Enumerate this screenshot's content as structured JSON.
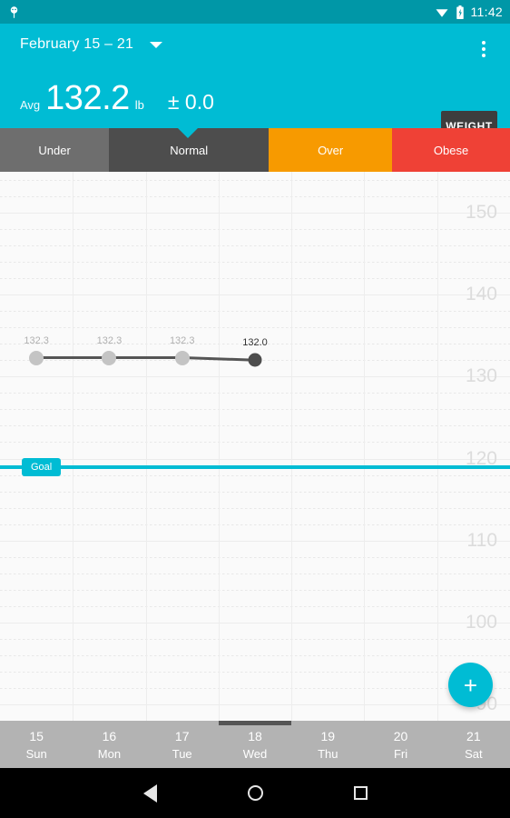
{
  "status_bar": {
    "notification_icon": "app-notification-icon",
    "wifi_icon": "wifi-icon",
    "battery_icon": "battery-charging-icon",
    "time": "11:42",
    "background": "#0097a7"
  },
  "header": {
    "date_range": "February 15 – 21",
    "dropdown_icon": "chevron-down-icon",
    "overflow_icon": "overflow-menu-icon",
    "avg_label": "Avg",
    "avg_value": "132.2",
    "avg_unit": "lb",
    "avg_delta": "± 0.0",
    "weight_button": "WEIGHT",
    "background": "#00bcd4"
  },
  "bmi_bar": {
    "segments": [
      {
        "label": "Under",
        "color": "#6e6e6e",
        "width_pct": 21.4
      },
      {
        "label": "Normal",
        "color": "#4d4d4d",
        "width_pct": 31.3
      },
      {
        "label": "Over",
        "color": "#f79a00",
        "width_pct": 24.2
      },
      {
        "label": "Obese",
        "color": "#ef4136",
        "width_pct": 23.1
      }
    ],
    "pointer_at_pct": 36.8,
    "pointer_color": "#00bcd4"
  },
  "chart_data": {
    "type": "line",
    "title": "",
    "xlabel": "",
    "ylabel": "",
    "ylim": [
      88,
      155
    ],
    "yticks": [
      150,
      140,
      130,
      120,
      110,
      100,
      90
    ],
    "grid": true,
    "categories": [
      "15 Sun",
      "16 Mon",
      "17 Tue",
      "18 Wed",
      "19 Thu",
      "20 Fri",
      "21 Sat"
    ],
    "x": [
      0,
      1,
      2,
      3
    ],
    "values": [
      132.3,
      132.3,
      132.3,
      132.0
    ],
    "point_labels": [
      "132.3",
      "132.3",
      "132.3",
      "132.0"
    ],
    "point_colors": [
      "#c4c4c4",
      "#c4c4c4",
      "#c4c4c4",
      "#4d4d4d"
    ],
    "label_colors": [
      "#b0b0b0",
      "#b0b0b0",
      "#b0b0b0",
      "#333333"
    ],
    "line_color": "#555555",
    "goal": {
      "label": "Goal",
      "value": 119.2,
      "color": "#00bcd4"
    }
  },
  "fab": {
    "icon": "plus-icon",
    "label": "+",
    "color": "#00bcd4"
  },
  "date_axis": {
    "selected_index": 3,
    "days": [
      {
        "num": "15",
        "day": "Sun"
      },
      {
        "num": "16",
        "day": "Mon"
      },
      {
        "num": "17",
        "day": "Tue"
      },
      {
        "num": "18",
        "day": "Wed"
      },
      {
        "num": "19",
        "day": "Thu"
      },
      {
        "num": "20",
        "day": "Fri"
      },
      {
        "num": "21",
        "day": "Sat"
      }
    ],
    "background": "#b3b3b3"
  },
  "nav_bar": {
    "back_icon": "back-triangle-icon",
    "home_icon": "home-circle-icon",
    "recents_icon": "recents-square-icon"
  }
}
